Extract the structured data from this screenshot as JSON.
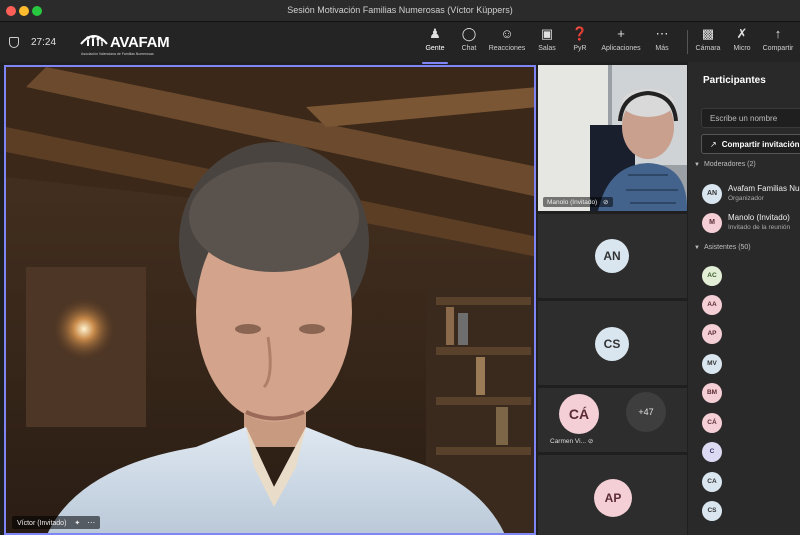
{
  "window": {
    "title": "Sesión Motivación Familias Numerosas (Víctor Küppers)"
  },
  "meeting": {
    "elapsed": "27:24"
  },
  "brand": {
    "name": "AVAFAM",
    "tagline": "Asociación Valenciana de Familias Numerosas"
  },
  "toolbar": {
    "items": [
      {
        "label": "Gente",
        "icon": "people-icon"
      },
      {
        "label": "Chat",
        "icon": "chat-icon"
      },
      {
        "label": "Reacciones",
        "icon": "reactions-icon"
      },
      {
        "label": "Salas",
        "icon": "rooms-icon"
      },
      {
        "label": "PyR",
        "icon": "qa-icon"
      },
      {
        "label": "Aplicaciones",
        "icon": "add-icon"
      },
      {
        "label": "Más",
        "icon": "more-icon"
      },
      {
        "label": "Cámara",
        "icon": "camera-icon"
      },
      {
        "label": "Micro",
        "icon": "mic-off-icon"
      },
      {
        "label": "Compartir",
        "icon": "share-icon"
      }
    ]
  },
  "stage": {
    "main_label": "Víctor (Invitado)",
    "thumb_video_label": "Manolo (Invitado)",
    "tiles": [
      {
        "initials": "AN"
      },
      {
        "initials": "CS"
      },
      {
        "initials": "CÁ",
        "name": "Carmen Vi..."
      },
      {
        "initials": "+47"
      },
      {
        "initials": "AP"
      }
    ]
  },
  "panel": {
    "title": "Participantes",
    "search_placeholder": "Escribe un nombre",
    "share_label": "Compartir invitación",
    "moderators_header": "Moderadores (2)",
    "moderators": [
      {
        "initials": "AN",
        "name": "Avafam Familias Numerosas",
        "role": "Organizador"
      },
      {
        "initials": "M",
        "name": "Manolo (Invitado)",
        "role": "Invitado de la reunión"
      }
    ],
    "attendees_header": "Asistentes (50)",
    "attendees": [
      "AC",
      "AA",
      "AP",
      "MV",
      "BM",
      "CÁ",
      "C",
      "CA",
      "CS"
    ]
  },
  "colors": {
    "accent": "#7f85f5",
    "panel_bg": "#292929"
  }
}
